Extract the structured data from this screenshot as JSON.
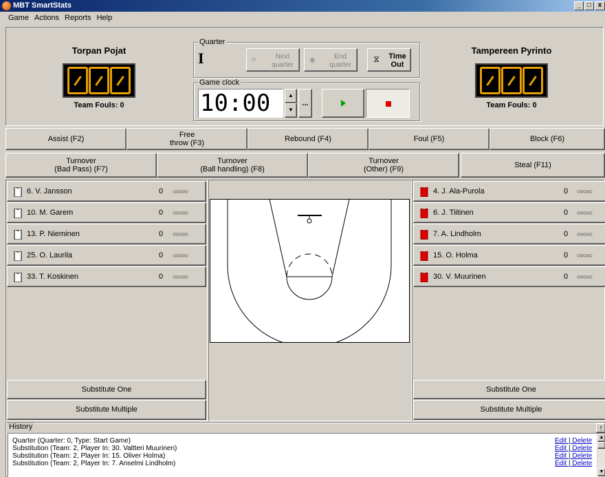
{
  "window": {
    "title": "MBT SmartStats"
  },
  "menu": [
    "Game",
    "Actions",
    "Reports",
    "Help"
  ],
  "home": {
    "name": "Torpan Pojat",
    "fouls_label": "Team Fouls: 0",
    "score": "000"
  },
  "away": {
    "name": "Tampereen Pyrinto",
    "fouls_label": "Team Fouls: 0",
    "score": "000"
  },
  "quarter": {
    "label": "Quarter",
    "value": "I",
    "next_line1": "Next",
    "next_line2": "quarter",
    "end_line1": "End",
    "end_line2": "quarter",
    "timeout_line1": "Time",
    "timeout_line2": "Out"
  },
  "clock": {
    "label": "Game clock",
    "value": "10:00",
    "more": "..."
  },
  "stats_row1": [
    "Assist (F2)",
    "Free throw (F3)",
    "Rebound (F4)",
    "Foul (F5)",
    "Block (F6)"
  ],
  "stats_row1_b": {
    "free_line1": "Free",
    "free_line2": "throw (F3)"
  },
  "stats_row2": {
    "bad_pass_1": "Turnover",
    "bad_pass_2": "(Bad Pass) (F7)",
    "ball_1": "Turnover",
    "ball_2": "(Ball handling) (F8)",
    "other_1": "Turnover",
    "other_2": "(Other) (F9)",
    "steal": "Steal (F11)"
  },
  "home_players": [
    {
      "name": "6. V. Jansson",
      "points": "0",
      "fouls": "○○○○○"
    },
    {
      "name": "10. M. Garem",
      "points": "0",
      "fouls": "○○○○○"
    },
    {
      "name": "13. P. Nieminen",
      "points": "0",
      "fouls": "○○○○○"
    },
    {
      "name": "25. O. Laurila",
      "points": "0",
      "fouls": "○○○○○"
    },
    {
      "name": "33. T. Koskinen",
      "points": "0",
      "fouls": "○○○○○"
    }
  ],
  "away_players": [
    {
      "name": "4. J. Ala-Purola",
      "points": "0",
      "fouls": "○○○○○"
    },
    {
      "name": "6. J. Tiitinen",
      "points": "0",
      "fouls": "○○○○○"
    },
    {
      "name": "7. A. Lindholm",
      "points": "0",
      "fouls": "○○○○○"
    },
    {
      "name": "15. O. Holma",
      "points": "0",
      "fouls": "○○○○○"
    },
    {
      "name": "30. V. Muurinen",
      "points": "0",
      "fouls": "○○○○○"
    }
  ],
  "substitute": {
    "one": "Substitute One",
    "multiple": "Substitute Multiple"
  },
  "history": {
    "label": "History",
    "edit": "Edit",
    "sep": " | ",
    "delete": "Delete",
    "rows": [
      "Quarter (Quarter: 0, Type: Start Game)",
      "Substitution (Team: 2, Player In: 30. Valtteri Muurinen)",
      "Substitution (Team: 2, Player In: 15. Oliver Holma)",
      "Substitution (Team: 2, Player In: 7. Anselmi Lindholm)"
    ]
  },
  "colors": {
    "home_jersey": "#ffffff",
    "away_jersey": "#e00000",
    "digit": "#e8a000",
    "play": "#00a000",
    "stop": "#e00000"
  }
}
